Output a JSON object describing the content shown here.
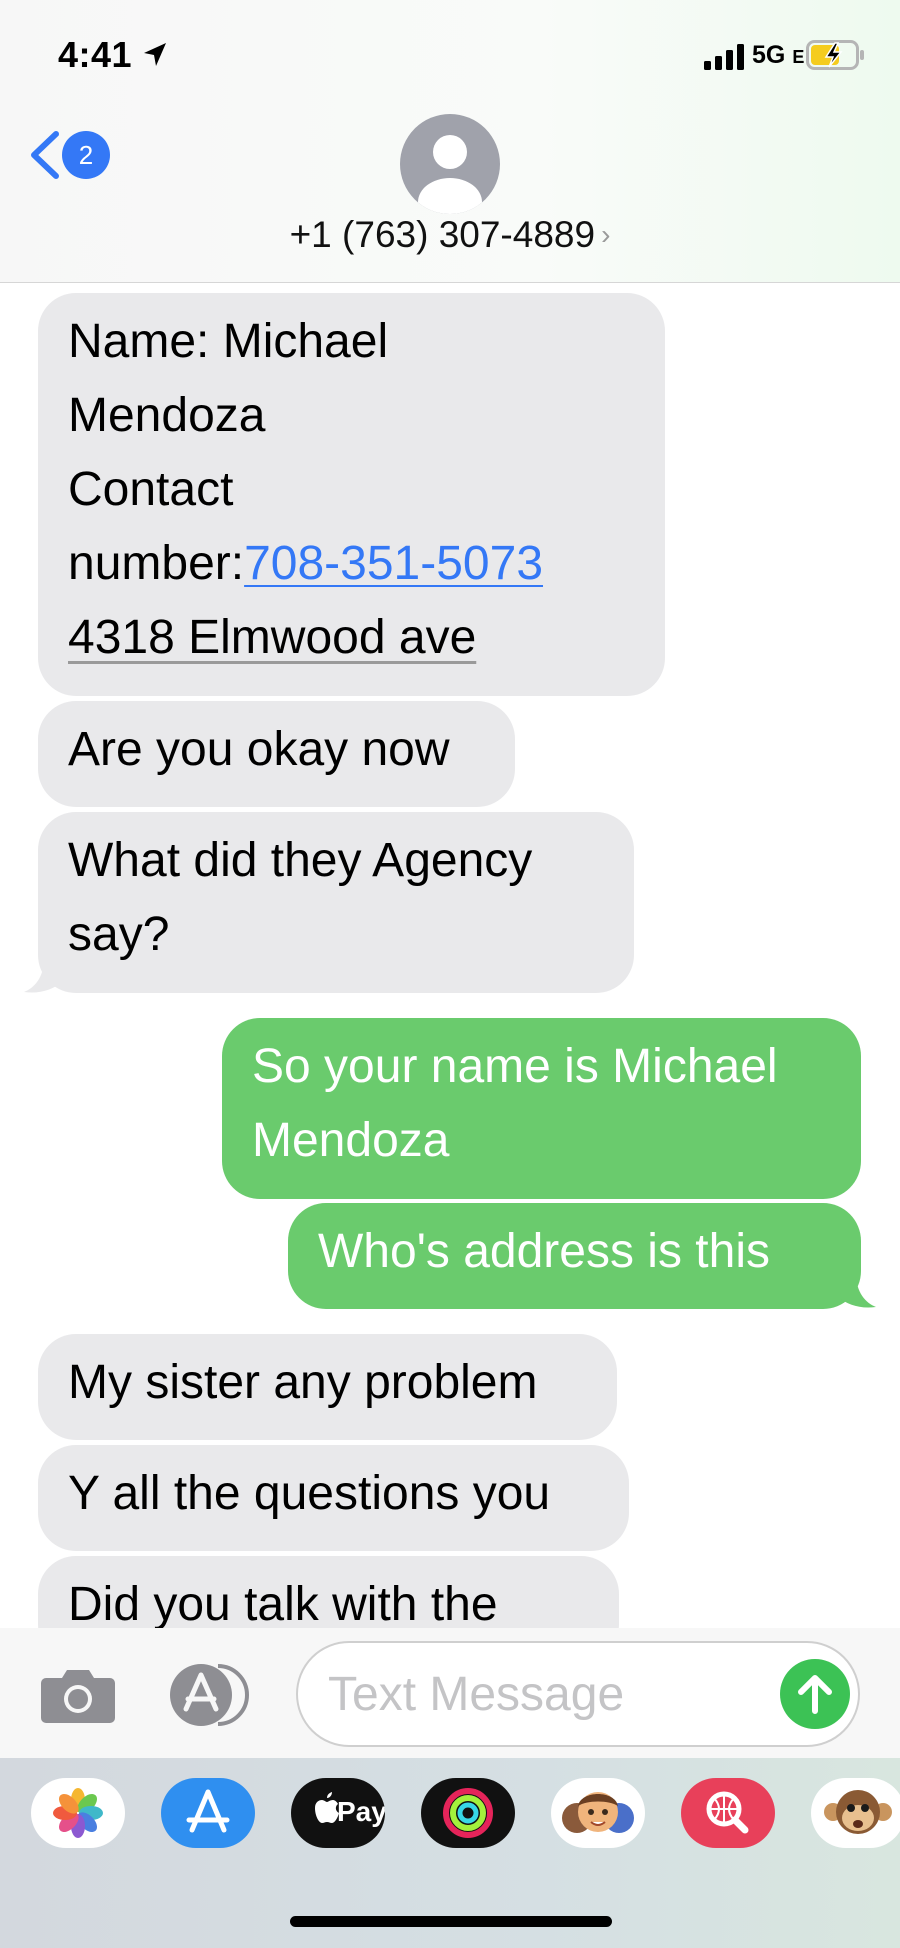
{
  "status_bar": {
    "time": "4:41",
    "network": "5G",
    "network_suffix": "E"
  },
  "nav": {
    "unread_count": "2",
    "contact": "+1 (763) 307-4889",
    "contact_chevron": "›"
  },
  "messages": [
    {
      "direction": "incoming",
      "lines": [
        "Name: Michael",
        "Mendoza",
        "Contact"
      ],
      "number_prefix": "number:",
      "number_link": "708-351-5073",
      "address": "4318 Elmwood ave"
    },
    {
      "direction": "incoming",
      "lines": [
        "Are you okay now"
      ]
    },
    {
      "direction": "incoming",
      "lines": [
        "What did they Agency",
        "say?"
      ]
    },
    {
      "direction": "outgoing",
      "lines": [
        "So your name is Michael",
        "Mendoza"
      ]
    },
    {
      "direction": "outgoing",
      "lines": [
        "Who's address is this"
      ]
    },
    {
      "direction": "incoming",
      "lines": [
        "My sister any problem"
      ]
    },
    {
      "direction": "incoming",
      "lines": [
        "Y all the questions you"
      ]
    },
    {
      "direction": "incoming",
      "lines": [
        "Did you talk with the"
      ]
    }
  ],
  "compose": {
    "placeholder": "Text Message"
  },
  "app_drawer": {
    "apps": [
      "photos-icon",
      "app-store-icon",
      "apple-pay-icon",
      "activity-icon",
      "memoji-icon",
      "web-search-icon",
      "animoji-monkey-icon"
    ],
    "apple_pay_label": "Pay"
  },
  "colors": {
    "incoming_bubble": "#e9e9eb",
    "outgoing_bubble": "#6acb6d",
    "accent": "#3478f6",
    "send": "#3cc255"
  }
}
